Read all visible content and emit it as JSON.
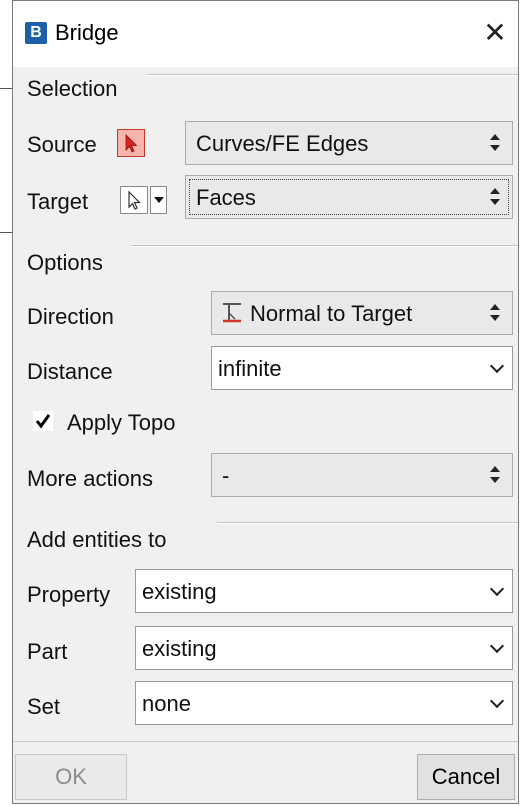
{
  "window": {
    "title": "Bridge",
    "app_icon_letter": "B",
    "close_glyph": "✕"
  },
  "selection": {
    "group_label": "Selection",
    "source_label": "Source",
    "source_value": "Curves/FE Edges",
    "target_label": "Target",
    "target_value": "Faces"
  },
  "options": {
    "group_label": "Options",
    "direction_label": "Direction",
    "direction_value": "Normal to Target",
    "distance_label": "Distance",
    "distance_value": "infinite",
    "apply_topo_label": "Apply Topo",
    "apply_topo_checked": true,
    "more_actions_label": "More actions",
    "more_actions_value": "-"
  },
  "add_entities": {
    "group_label": "Add entities to",
    "property_label": "Property",
    "property_value": "existing",
    "part_label": "Part",
    "part_value": "existing",
    "set_label": "Set",
    "set_value": "none"
  },
  "footer": {
    "ok_label": "OK",
    "cancel_label": "Cancel"
  },
  "colors": {
    "accent_icon": "#1d5fa8",
    "active_picker": "#f7b4ad",
    "direction_icon": "#d0342c"
  }
}
